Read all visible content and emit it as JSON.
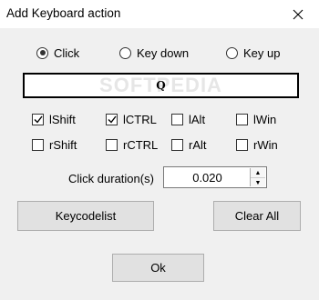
{
  "window": {
    "title": "Add Keyboard action"
  },
  "mode": {
    "options": [
      "Click",
      "Key down",
      "Key up"
    ],
    "selected": "Click"
  },
  "key_display": {
    "value": "Q",
    "watermark": "SOFTPEDIA"
  },
  "modifiers": {
    "lshift": {
      "label": "lShift",
      "checked": true
    },
    "lctrl": {
      "label": "lCTRL",
      "checked": true
    },
    "lalt": {
      "label": "lAlt",
      "checked": false
    },
    "lwin": {
      "label": "lWin",
      "checked": false
    },
    "rshift": {
      "label": "rShift",
      "checked": false
    },
    "rctrl": {
      "label": "rCTRL",
      "checked": false
    },
    "ralt": {
      "label": "rAlt",
      "checked": false
    },
    "rwin": {
      "label": "rWin",
      "checked": false
    }
  },
  "duration": {
    "label": "Click duration(s)",
    "value": "0.020"
  },
  "buttons": {
    "keycodelist": "Keycodelist",
    "clear_all": "Clear All",
    "ok": "Ok"
  },
  "icons": {
    "close": "close-icon",
    "check": "checkmark-icon",
    "spin_up": "up-arrow-icon",
    "spin_down": "down-arrow-icon"
  }
}
